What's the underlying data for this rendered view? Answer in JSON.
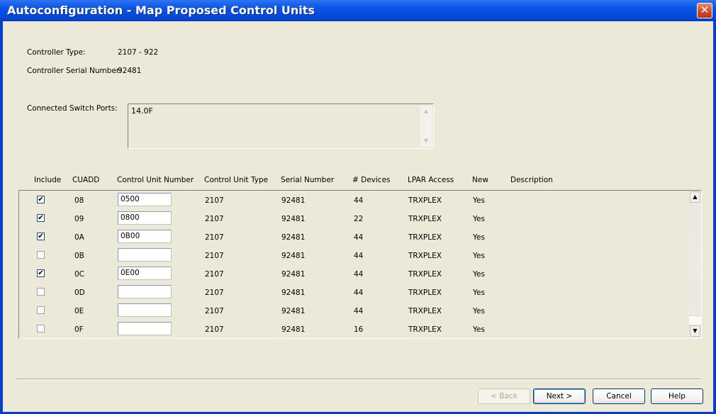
{
  "window": {
    "title": "Autoconfiguration - Map Proposed Control Units",
    "close_label": "✕"
  },
  "info": {
    "controller_type_label": "Controller Type:",
    "controller_type_value": "2107 - 922",
    "serial_label": "Controller Serial Number:",
    "serial_value": "92481",
    "ports_label": "Connected Switch Ports:",
    "ports_value": "14.0F"
  },
  "columns": [
    "Include",
    "CUADD",
    "Control Unit Number",
    "Control Unit Type",
    "Serial Number",
    "# Devices",
    "LPAR Access",
    "New",
    "Description"
  ],
  "rows": [
    {
      "include": true,
      "cuadd": "08",
      "cu_number": "0500",
      "cu_type": "2107",
      "serial": "92481",
      "devices": "44",
      "lpar": "TRXPLEX",
      "new": "Yes",
      "description": ""
    },
    {
      "include": true,
      "cuadd": "09",
      "cu_number": "0800",
      "cu_type": "2107",
      "serial": "92481",
      "devices": "22",
      "lpar": "TRXPLEX",
      "new": "Yes",
      "description": ""
    },
    {
      "include": true,
      "cuadd": "0A",
      "cu_number": "0B00",
      "cu_type": "2107",
      "serial": "92481",
      "devices": "44",
      "lpar": "TRXPLEX",
      "new": "Yes",
      "description": ""
    },
    {
      "include": false,
      "cuadd": "0B",
      "cu_number": "",
      "cu_type": "2107",
      "serial": "92481",
      "devices": "44",
      "lpar": "TRXPLEX",
      "new": "Yes",
      "description": ""
    },
    {
      "include": true,
      "cuadd": "0C",
      "cu_number": "0E00",
      "cu_type": "2107",
      "serial": "92481",
      "devices": "44",
      "lpar": "TRXPLEX",
      "new": "Yes",
      "description": ""
    },
    {
      "include": false,
      "cuadd": "0D",
      "cu_number": "",
      "cu_type": "2107",
      "serial": "92481",
      "devices": "44",
      "lpar": "TRXPLEX",
      "new": "Yes",
      "description": ""
    },
    {
      "include": false,
      "cuadd": "0E",
      "cu_number": "",
      "cu_type": "2107",
      "serial": "92481",
      "devices": "44",
      "lpar": "TRXPLEX",
      "new": "Yes",
      "description": ""
    },
    {
      "include": false,
      "cuadd": "0F",
      "cu_number": "",
      "cu_type": "2107",
      "serial": "92481",
      "devices": "16",
      "lpar": "TRXPLEX",
      "new": "Yes",
      "description": ""
    }
  ],
  "buttons": {
    "back": "< Back",
    "next": "Next >",
    "cancel": "Cancel",
    "help": "Help"
  },
  "colors": {
    "titlebar": "#0a53e6",
    "dialog_bg": "#ece9d8",
    "close_button": "#d2482a"
  }
}
